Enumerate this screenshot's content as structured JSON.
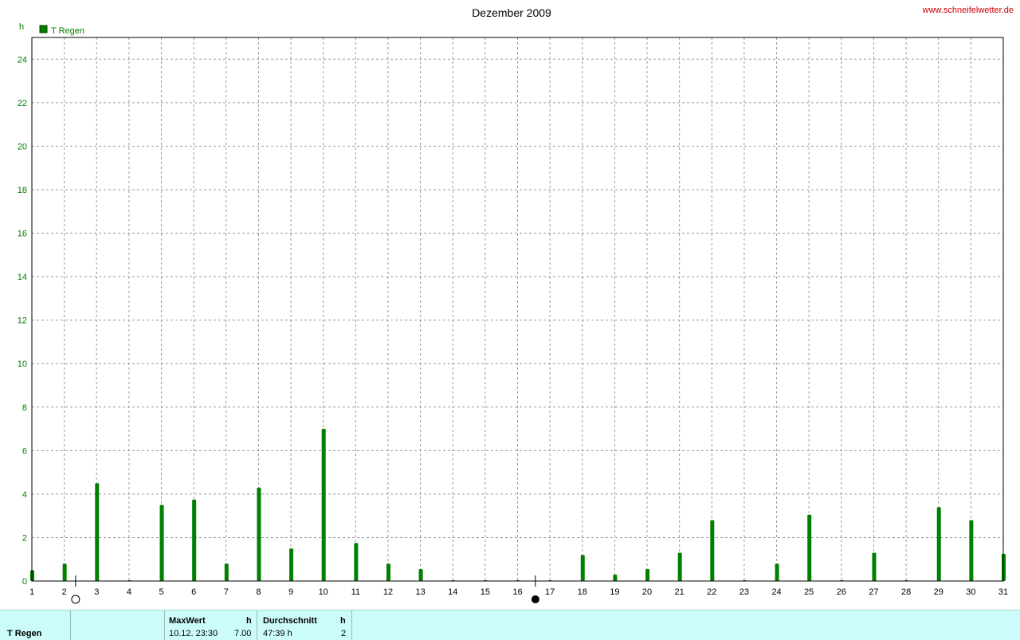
{
  "chart_data": {
    "type": "bar",
    "title": "Dezember 2009",
    "ylabel": "h",
    "xlabel": "",
    "ylim": [
      0,
      25
    ],
    "yticks": [
      0,
      2,
      4,
      6,
      8,
      10,
      12,
      14,
      16,
      18,
      20,
      22,
      24
    ],
    "xlim": [
      1,
      31
    ],
    "grid": true,
    "legend_position": "top-left",
    "series": [
      {
        "name": "T Regen",
        "color": "#007f00",
        "days": [
          1,
          2,
          3,
          4,
          5,
          6,
          7,
          8,
          9,
          10,
          11,
          12,
          13,
          14,
          15,
          16,
          17,
          18,
          19,
          20,
          21,
          22,
          23,
          24,
          25,
          26,
          27,
          28,
          29,
          30,
          31
        ],
        "values": [
          0.5,
          0.8,
          4.5,
          0,
          3.5,
          3.75,
          0.8,
          4.3,
          1.5,
          7.0,
          1.75,
          0.8,
          0.55,
          0,
          0,
          0,
          0,
          1.2,
          0.3,
          0.55,
          1.3,
          2.8,
          0,
          0.8,
          3.05,
          0,
          1.3,
          0,
          3.4,
          2.8,
          1.25
        ]
      }
    ],
    "moon_phases": [
      {
        "phase": "full-moon",
        "day": 2.35
      },
      {
        "phase": "new-moon",
        "day": 16.55
      }
    ]
  },
  "watermark": "www.schneifelwetter.de",
  "colors": {
    "series": "#007f00",
    "watermark": "#cc0000",
    "footer_bg": "#ccfcf9",
    "grid": "#9a9a9a"
  },
  "footer": {
    "row_label": "T Regen",
    "max_header": "MaxWert",
    "max_unit": "h",
    "max_date": "10.12.  23:30",
    "max_value": "7.00",
    "avg_header": "Durchschnitt",
    "avg_unit": "h",
    "avg_value": "47:39 h",
    "avg_count": "2"
  }
}
